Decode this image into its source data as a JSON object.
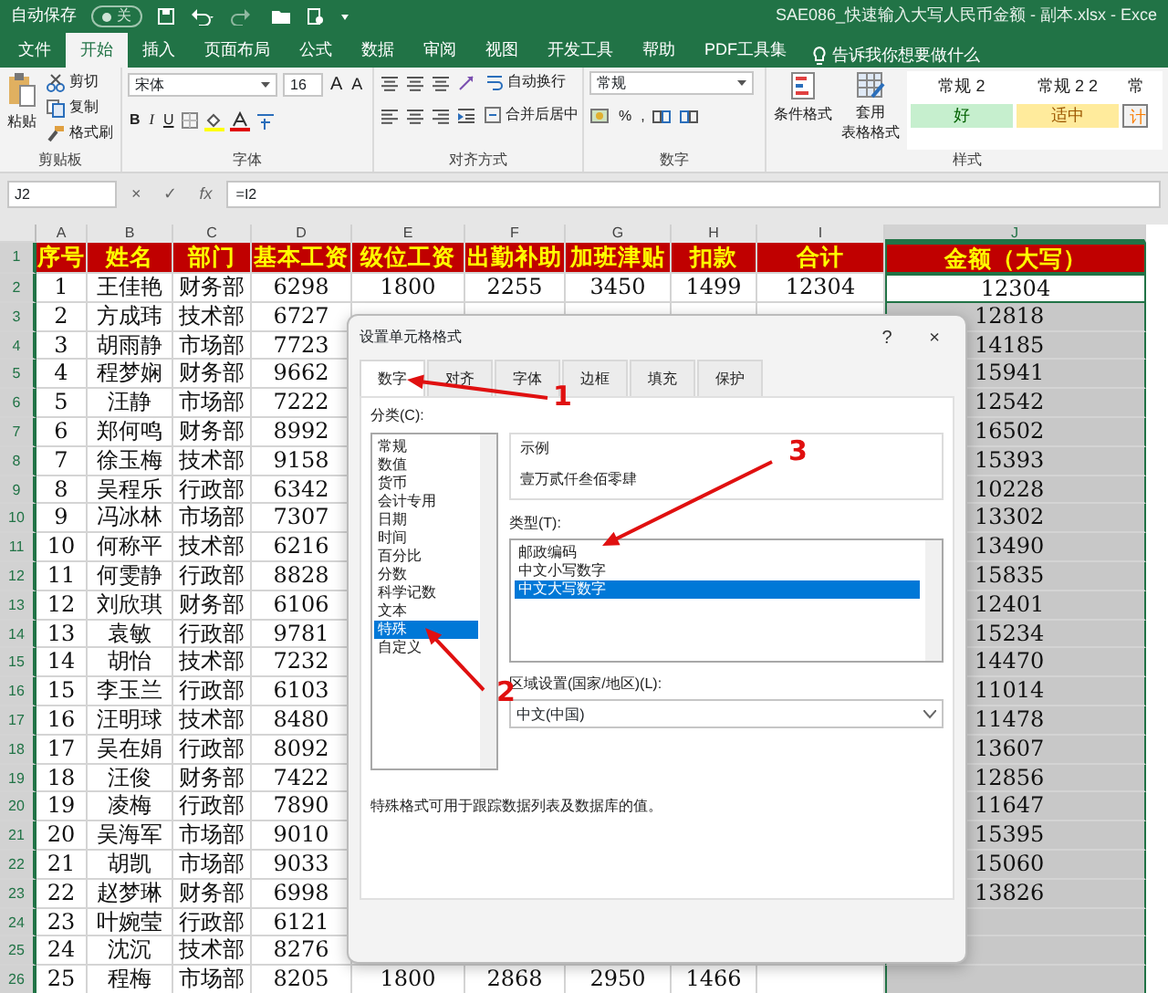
{
  "title_bar": {
    "autosave_label": "自动保存",
    "autosave_on": false,
    "autosave_state": "关",
    "title": "SAE086_快速输入大写人民币金额 - 副本.xlsx  -  Exce"
  },
  "ribbon_tabs": [
    {
      "label": "文件",
      "selected": false
    },
    {
      "label": "开始",
      "selected": true
    },
    {
      "label": "插入",
      "selected": false
    },
    {
      "label": "页面布局",
      "selected": false
    },
    {
      "label": "公式",
      "selected": false
    },
    {
      "label": "数据",
      "selected": false
    },
    {
      "label": "审阅",
      "selected": false
    },
    {
      "label": "视图",
      "selected": false
    },
    {
      "label": "开发工具",
      "selected": false
    },
    {
      "label": "帮助",
      "selected": false
    },
    {
      "label": "PDF工具集",
      "selected": false
    }
  ],
  "tell_me": "告诉我你想要做什么",
  "clipboard": {
    "paste": "粘贴",
    "cut": "剪切",
    "copy": "复制",
    "format_painter": "格式刷",
    "group": "剪贴板"
  },
  "font": {
    "name": "宋体",
    "size": "16",
    "grow": "A",
    "shrink": "A",
    "bold": "B",
    "italic": "I",
    "underline": "U",
    "group": "字体"
  },
  "alignment": {
    "wrap": "自动换行",
    "merge": "合并后居中",
    "group": "对齐方式"
  },
  "number": {
    "format": "常规",
    "percent": "%",
    "comma": ",",
    "group": "数字"
  },
  "style_buttons": {
    "conditional": "条件格式",
    "table": [
      "套用",
      "表格格式"
    ]
  },
  "styles": [
    {
      "label": "常规 2",
      "kind": "normal",
      "color": "#ffffff"
    },
    {
      "label": "常规 2 2",
      "kind": "normal",
      "color": "#ffffff"
    },
    {
      "label": "常",
      "kind": "normal",
      "color": "#ffffff"
    },
    {
      "label": "好",
      "kind": "good",
      "color": "#c6efce"
    },
    {
      "label": "适中",
      "kind": "neutral",
      "color": "#ffeb9c"
    },
    {
      "label": "计",
      "kind": "calc",
      "color": "#f2f2f2"
    }
  ],
  "styles_group": "样式",
  "formula_bar": {
    "name_box": "J2",
    "cancel": "×",
    "enter": "✓",
    "fx": "fx",
    "formula": "=I2"
  },
  "columns": [
    {
      "label": "A",
      "selected": false
    },
    {
      "label": "B",
      "selected": false
    },
    {
      "label": "C",
      "selected": false
    },
    {
      "label": "D",
      "selected": false
    },
    {
      "label": "E",
      "selected": false
    },
    {
      "label": "F",
      "selected": false
    },
    {
      "label": "G",
      "selected": false
    },
    {
      "label": "H",
      "selected": false
    },
    {
      "label": "I",
      "selected": false
    },
    {
      "label": "J",
      "selected": true
    }
  ],
  "header_row": {
    "number": "1",
    "cells": [
      "序号",
      "姓名",
      "部门",
      "基本工资",
      "级位工资",
      "出勤补助",
      "加班津贴",
      "扣款",
      "合计",
      "金额（大写）"
    ]
  },
  "rows": [
    {
      "number": "2",
      "cells": [
        "1",
        "王佳艳",
        "财务部",
        "6298"
      ],
      "more_cells": [
        "1800",
        "2255",
        "3450",
        "1499",
        "12304"
      ],
      "amount": "12304",
      "active": true
    },
    {
      "number": "3",
      "cells": [
        "2",
        "方成玮",
        "技术部",
        "6727"
      ],
      "amount": "12818",
      "active": false
    },
    {
      "number": "4",
      "cells": [
        "3",
        "胡雨静",
        "市场部",
        "7723"
      ],
      "amount": "14185",
      "active": false
    },
    {
      "number": "5",
      "cells": [
        "4",
        "程梦娴",
        "财务部",
        "9662"
      ],
      "amount": "15941",
      "active": false
    },
    {
      "number": "6",
      "cells": [
        "5",
        "汪静",
        "市场部",
        "7222"
      ],
      "amount": "12542",
      "active": false
    },
    {
      "number": "7",
      "cells": [
        "6",
        "郑何鸣",
        "财务部",
        "8992"
      ],
      "amount": "16502",
      "active": false
    },
    {
      "number": "8",
      "cells": [
        "7",
        "徐玉梅",
        "技术部",
        "9158"
      ],
      "amount": "15393",
      "active": false
    },
    {
      "number": "9",
      "cells": [
        "8",
        "吴程乐",
        "行政部",
        "6342"
      ],
      "amount": "10228",
      "active": false
    },
    {
      "number": "10",
      "cells": [
        "9",
        "冯冰林",
        "市场部",
        "7307"
      ],
      "amount": "13302",
      "active": false
    },
    {
      "number": "11",
      "cells": [
        "10",
        "何称平",
        "技术部",
        "6216"
      ],
      "amount": "13490",
      "active": false
    },
    {
      "number": "12",
      "cells": [
        "11",
        "何雯静",
        "行政部",
        "8828"
      ],
      "amount": "15835",
      "active": false
    },
    {
      "number": "13",
      "cells": [
        "12",
        "刘欣琪",
        "财务部",
        "6106"
      ],
      "amount": "12401",
      "active": false
    },
    {
      "number": "14",
      "cells": [
        "13",
        "袁敏",
        "行政部",
        "9781"
      ],
      "amount": "15234",
      "active": false
    },
    {
      "number": "15",
      "cells": [
        "14",
        "胡怡",
        "技术部",
        "7232"
      ],
      "amount": "14470",
      "active": false
    },
    {
      "number": "16",
      "cells": [
        "15",
        "李玉兰",
        "行政部",
        "6103"
      ],
      "amount": "11014",
      "active": false
    },
    {
      "number": "17",
      "cells": [
        "16",
        "汪明球",
        "技术部",
        "8480"
      ],
      "amount": "11478",
      "active": false
    },
    {
      "number": "18",
      "cells": [
        "17",
        "吴在娟",
        "行政部",
        "8092"
      ],
      "amount": "13607",
      "active": false
    },
    {
      "number": "19",
      "cells": [
        "18",
        "汪俊",
        "财务部",
        "7422"
      ],
      "amount": "12856",
      "active": false
    },
    {
      "number": "20",
      "cells": [
        "19",
        "凌梅",
        "行政部",
        "7890"
      ],
      "amount": "11647",
      "active": false
    },
    {
      "number": "21",
      "cells": [
        "20",
        "吴海军",
        "市场部",
        "9010"
      ],
      "amount": "15395",
      "active": false
    },
    {
      "number": "22",
      "cells": [
        "21",
        "胡凯",
        "市场部",
        "9033"
      ],
      "amount": "15060",
      "active": false
    },
    {
      "number": "23",
      "cells": [
        "22",
        "赵梦琳",
        "财务部",
        "6998"
      ],
      "amount": "13826",
      "active": false
    },
    {
      "number": "24",
      "cells": [
        "23",
        "叶婉莹",
        "行政部",
        "6121"
      ],
      "active": false
    },
    {
      "number": "25",
      "cells": [
        "24",
        "沈沉",
        "技术部",
        "8276"
      ],
      "active": false
    },
    {
      "number": "26",
      "cells": [
        "25",
        "程梅",
        "市场部",
        "8205"
      ],
      "more_cells": [
        "1800",
        "2868",
        "2950",
        "1466"
      ],
      "active": false
    }
  ],
  "dialog": {
    "title": "设置单元格格式",
    "help": "?",
    "close": "×",
    "tabs": [
      {
        "label": "数字",
        "selected": true
      },
      {
        "label": "对齐",
        "selected": false
      },
      {
        "label": "字体",
        "selected": false
      },
      {
        "label": "边框",
        "selected": false
      },
      {
        "label": "填充",
        "selected": false
      },
      {
        "label": "保护",
        "selected": false
      }
    ],
    "category_label": "分类(C):",
    "categories": [
      {
        "label": "常规",
        "selected": false
      },
      {
        "label": "数值",
        "selected": false
      },
      {
        "label": "货币",
        "selected": false
      },
      {
        "label": "会计专用",
        "selected": false
      },
      {
        "label": "日期",
        "selected": false
      },
      {
        "label": "时间",
        "selected": false
      },
      {
        "label": "百分比",
        "selected": false
      },
      {
        "label": "分数",
        "selected": false
      },
      {
        "label": "科学记数",
        "selected": false
      },
      {
        "label": "文本",
        "selected": false
      },
      {
        "label": "特殊",
        "selected": true
      },
      {
        "label": "自定义",
        "selected": false
      }
    ],
    "sample_label": "示例",
    "sample": "壹万贰仟叁佰零肆",
    "type_label": "类型(T):",
    "types": [
      {
        "label": "邮政编码",
        "selected": false
      },
      {
        "label": "中文小写数字",
        "selected": false
      },
      {
        "label": "中文大写数字",
        "selected": true
      }
    ],
    "locale_label": "区域设置(国家/地区)(L):",
    "locale": "中文(中国)",
    "description": "特殊格式可用于跟踪数据列表及数据库的值。"
  },
  "annotations": [
    {
      "label": "1"
    },
    {
      "label": "2"
    },
    {
      "label": "3"
    }
  ]
}
